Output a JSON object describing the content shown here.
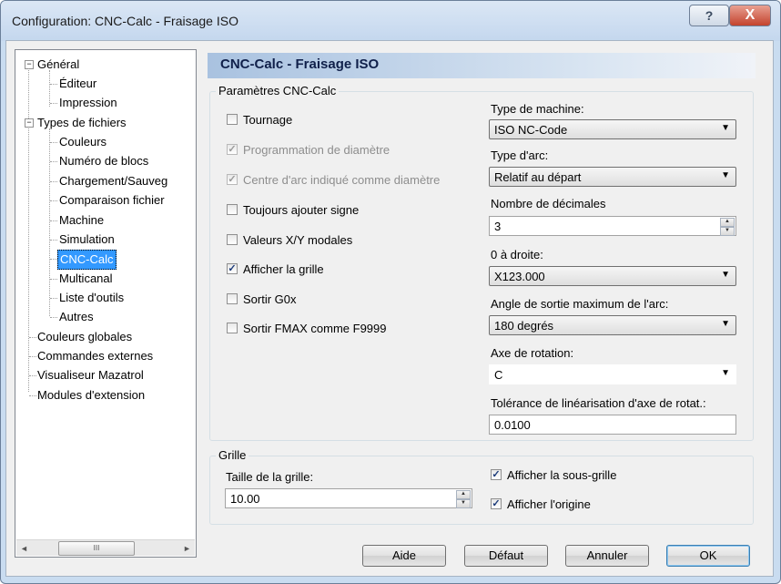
{
  "window": {
    "title": "Configuration: CNC-Calc - Fraisage ISO",
    "help_glyph": "?",
    "close_glyph": "X"
  },
  "tree": {
    "items": [
      {
        "label": "Général"
      },
      {
        "label": "Éditeur"
      },
      {
        "label": "Impression"
      },
      {
        "label": "Types de fichiers"
      },
      {
        "label": "Couleurs"
      },
      {
        "label": "Numéro de blocs"
      },
      {
        "label": "Chargement/Sauveg"
      },
      {
        "label": "Comparaison fichier"
      },
      {
        "label": "Machine"
      },
      {
        "label": "Simulation"
      },
      {
        "label": "CNC-Calc"
      },
      {
        "label": "Multicanal"
      },
      {
        "label": "Liste d'outils"
      },
      {
        "label": "Autres"
      },
      {
        "label": "Couleurs globales"
      },
      {
        "label": "Commandes externes"
      },
      {
        "label": "Visualiseur Mazatrol"
      },
      {
        "label": "Modules d'extension"
      }
    ],
    "selected": "CNC-Calc",
    "scroll_left": "◄",
    "scroll_right": "►",
    "thumb_grip": "III"
  },
  "panel": {
    "header": "CNC-Calc - Fraisage ISO"
  },
  "params": {
    "group_label": "Paramètres CNC-Calc",
    "checkboxes": [
      {
        "label": "Tournage",
        "checked": false,
        "enabled": true
      },
      {
        "label": "Programmation de diamètre",
        "checked": true,
        "enabled": false
      },
      {
        "label": "Centre d'arc indiqué comme diamètre",
        "checked": true,
        "enabled": false
      },
      {
        "label": "Toujours ajouter signe",
        "checked": false,
        "enabled": true
      },
      {
        "label": "Valeurs X/Y modales",
        "checked": false,
        "enabled": true
      },
      {
        "label": "Afficher la grille",
        "checked": true,
        "enabled": true
      },
      {
        "label": "Sortir G0x",
        "checked": false,
        "enabled": true
      },
      {
        "label": "Sortir FMAX comme F9999",
        "checked": false,
        "enabled": true
      }
    ],
    "check_glyph": "✓",
    "machine_type_label": "Type de machine:",
    "machine_type_value": "ISO NC-Code",
    "arc_type_label": "Type d'arc:",
    "arc_type_value": "Relatif au départ",
    "decimals_label": "Nombre de décimales",
    "decimals_value": "3",
    "zero_right_label": "0 à droite:",
    "zero_right_value": "X123.000",
    "max_arc_angle_label": "Angle de sortie maximum de l'arc:",
    "max_arc_angle_value": "180 degrés",
    "rotation_axis_label": "Axe de rotation:",
    "rotation_axis_value": "C",
    "linearization_label": "Tolérance de linéarisation d'axe de rotat.:",
    "linearization_value": "0.0100",
    "dropdown_glyph": "▼",
    "spin_up": "▲",
    "spin_down": "▼"
  },
  "grid": {
    "group_label": "Grille",
    "size_label": "Taille de la grille:",
    "size_value": "10.00",
    "show_subgrid_label": "Afficher la sous-grille",
    "show_subgrid_checked": true,
    "show_origin_label": "Afficher l'origine",
    "show_origin_checked": true
  },
  "buttons": {
    "help": "Aide",
    "default": "Défaut",
    "cancel": "Annuler",
    "ok": "OK"
  }
}
